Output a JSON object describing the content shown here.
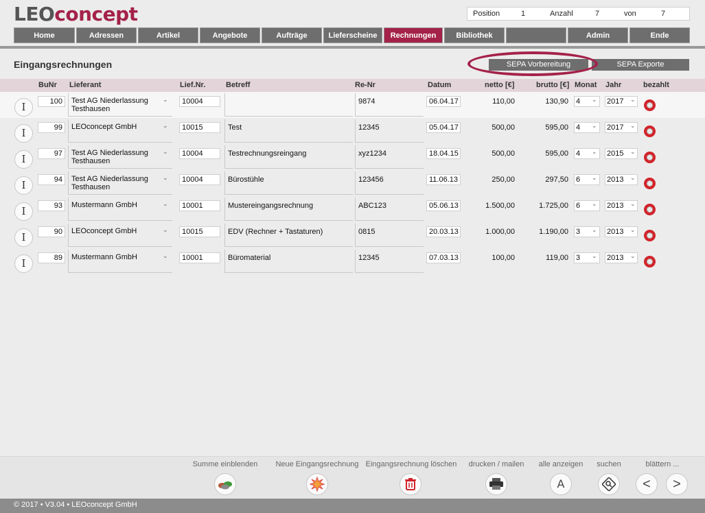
{
  "logo": {
    "part1": "LEO",
    "part2": "concept"
  },
  "position": {
    "position_label": "Position",
    "position_value": "1",
    "anzahl_label": "Anzahl",
    "anzahl_value": "7",
    "von_label": "von",
    "von_value": "7"
  },
  "nav": {
    "items": [
      {
        "label": "Home"
      },
      {
        "label": "Adressen"
      },
      {
        "label": "Artikel"
      },
      {
        "label": "Angebote"
      },
      {
        "label": "Aufträge"
      },
      {
        "label": "Lieferscheine"
      },
      {
        "label": "Rechnungen"
      },
      {
        "label": "Bibliothek"
      },
      {
        "label": ""
      },
      {
        "label": "Admin"
      },
      {
        "label": "Ende"
      }
    ],
    "active_index": 6
  },
  "page": {
    "title": "Eingangsrechnungen",
    "sepa_vorbereitung": "SEPA Vorbereitung",
    "sepa_exporte": "SEPA Exporte"
  },
  "columns": {
    "bunr": "BuNr",
    "lieferant": "Lieferant",
    "liefnr": "Lief.Nr.",
    "betreff": "Betreff",
    "renr": "Re-Nr",
    "datum": "Datum",
    "netto": "netto [€]",
    "brutto": "brutto [€]",
    "monat": "Monat",
    "jahr": "Jahr",
    "bezahlt": "bezahlt"
  },
  "rows": [
    {
      "icon": "I",
      "bunr": "100",
      "lieferant1": "Test AG Niederlassung",
      "lieferant2": "Testhausen",
      "liefnr": "10004",
      "betreff": "",
      "renr": "9874",
      "datum": "06.04.17",
      "netto": "110,00",
      "brutto": "130,90",
      "monat": "4",
      "jahr": "2017"
    },
    {
      "icon": "I",
      "bunr": "99",
      "lieferant1": "LEOconcept GmbH",
      "lieferant2": "",
      "liefnr": "10015",
      "betreff": "Test",
      "renr": "12345",
      "datum": "05.04.17",
      "netto": "500,00",
      "brutto": "595,00",
      "monat": "4",
      "jahr": "2017"
    },
    {
      "icon": "I",
      "bunr": "97",
      "lieferant1": "Test AG Niederlassung",
      "lieferant2": "Testhausen",
      "liefnr": "10004",
      "betreff": "Testrechnungsreingang",
      "renr": "xyz1234",
      "datum": "18.04.15",
      "netto": "500,00",
      "brutto": "595,00",
      "monat": "4",
      "jahr": "2015"
    },
    {
      "icon": "I",
      "bunr": "94",
      "lieferant1": "Test AG Niederlassung",
      "lieferant2": "Testhausen",
      "liefnr": "10004",
      "betreff": "Bürostühle",
      "renr": "123456",
      "datum": "11.06.13",
      "netto": "250,00",
      "brutto": "297,50",
      "monat": "6",
      "jahr": "2013"
    },
    {
      "icon": "I",
      "bunr": "93",
      "lieferant1": "Mustermann GmbH",
      "lieferant2": "",
      "liefnr": "10001",
      "betreff": "Mustereingangsrechnung",
      "renr": "ABC123",
      "datum": "05.06.13",
      "netto": "1.500,00",
      "brutto": "1.725,00",
      "monat": "6",
      "jahr": "2013"
    },
    {
      "icon": "I",
      "bunr": "90",
      "lieferant1": "LEOconcept GmbH",
      "lieferant2": "",
      "liefnr": "10015",
      "betreff": "EDV (Rechner + Tastaturen)",
      "renr": "0815",
      "datum": "20.03.13",
      "netto": "1.000,00",
      "brutto": "1.190,00",
      "monat": "3",
      "jahr": "2013"
    },
    {
      "icon": "I",
      "bunr": "89",
      "lieferant1": "Mustermann GmbH",
      "lieferant2": "",
      "liefnr": "10001",
      "betreff": "Büromaterial",
      "renr": "12345",
      "datum": "07.03.13",
      "netto": "100,00",
      "brutto": "119,00",
      "monat": "3",
      "jahr": "2013"
    }
  ],
  "toolbar": {
    "summe": "Summe einblenden",
    "neue": "Neue Eingangsrechnung",
    "loeschen": "Eingangsrechnung löschen",
    "drucken": "drucken / mailen",
    "alle": "alle anzeigen",
    "alle_icon": "A",
    "suchen": "suchen",
    "blaettern": "blättern ...",
    "prev_icon": "<",
    "next_icon": ">"
  },
  "footer": {
    "text": "© 2017 • V3.04 • LEOconcept GmbH"
  },
  "colors": {
    "accent": "#a4224a",
    "nav_bg": "#6e6e6e"
  }
}
